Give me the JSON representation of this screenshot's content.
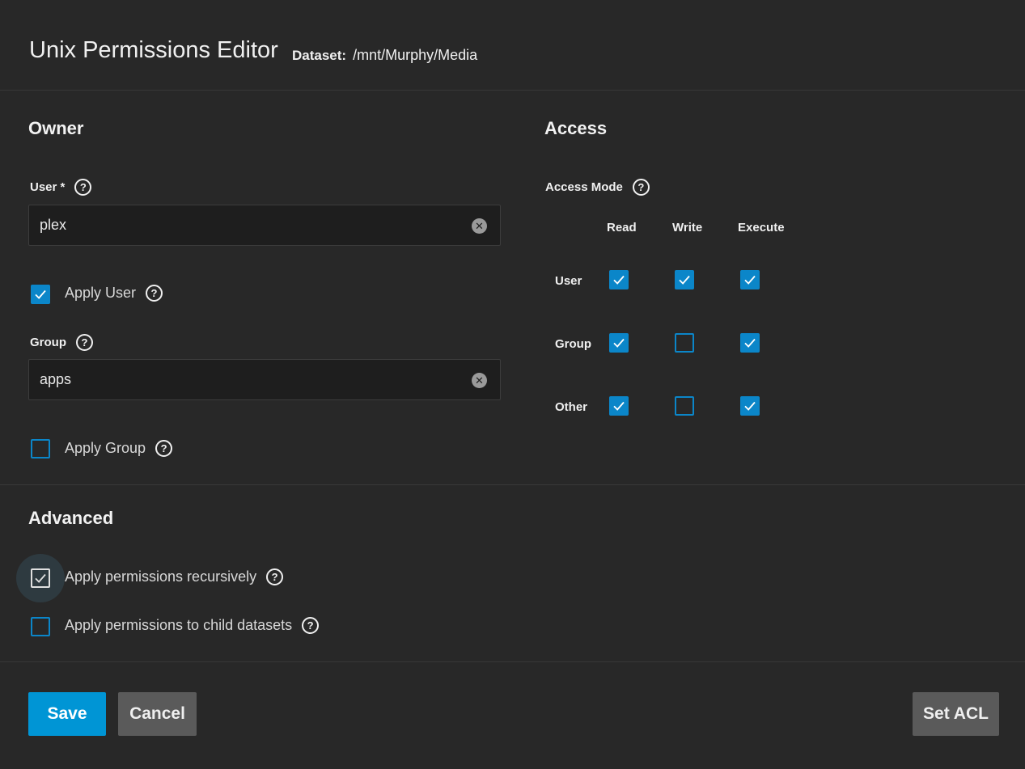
{
  "header": {
    "title": "Unix Permissions Editor",
    "dataset_label": "Dataset:",
    "dataset_path": "/mnt/Murphy/Media"
  },
  "owner": {
    "section_title": "Owner",
    "user_label": "User *",
    "user_value": "plex",
    "apply_user_label": "Apply User",
    "apply_user_checked": true,
    "group_label": "Group",
    "group_value": "apps",
    "apply_group_label": "Apply Group",
    "apply_group_checked": false
  },
  "access": {
    "section_title": "Access",
    "mode_label": "Access Mode",
    "columns": [
      "Read",
      "Write",
      "Execute"
    ],
    "rows": [
      {
        "label": "User",
        "read": true,
        "write": true,
        "execute": true
      },
      {
        "label": "Group",
        "read": true,
        "write": false,
        "execute": true
      },
      {
        "label": "Other",
        "read": true,
        "write": false,
        "execute": true
      }
    ]
  },
  "advanced": {
    "section_title": "Advanced",
    "recursive_label": "Apply permissions recursively",
    "recursive_checked": true,
    "child_label": "Apply permissions to child datasets",
    "child_checked": false
  },
  "footer": {
    "save_label": "Save",
    "cancel_label": "Cancel",
    "set_acl_label": "Set ACL"
  },
  "colors": {
    "background": "#282828",
    "accent": "#0b86c9",
    "primary_button": "#0095d5",
    "secondary_button": "#5a5a5a"
  }
}
